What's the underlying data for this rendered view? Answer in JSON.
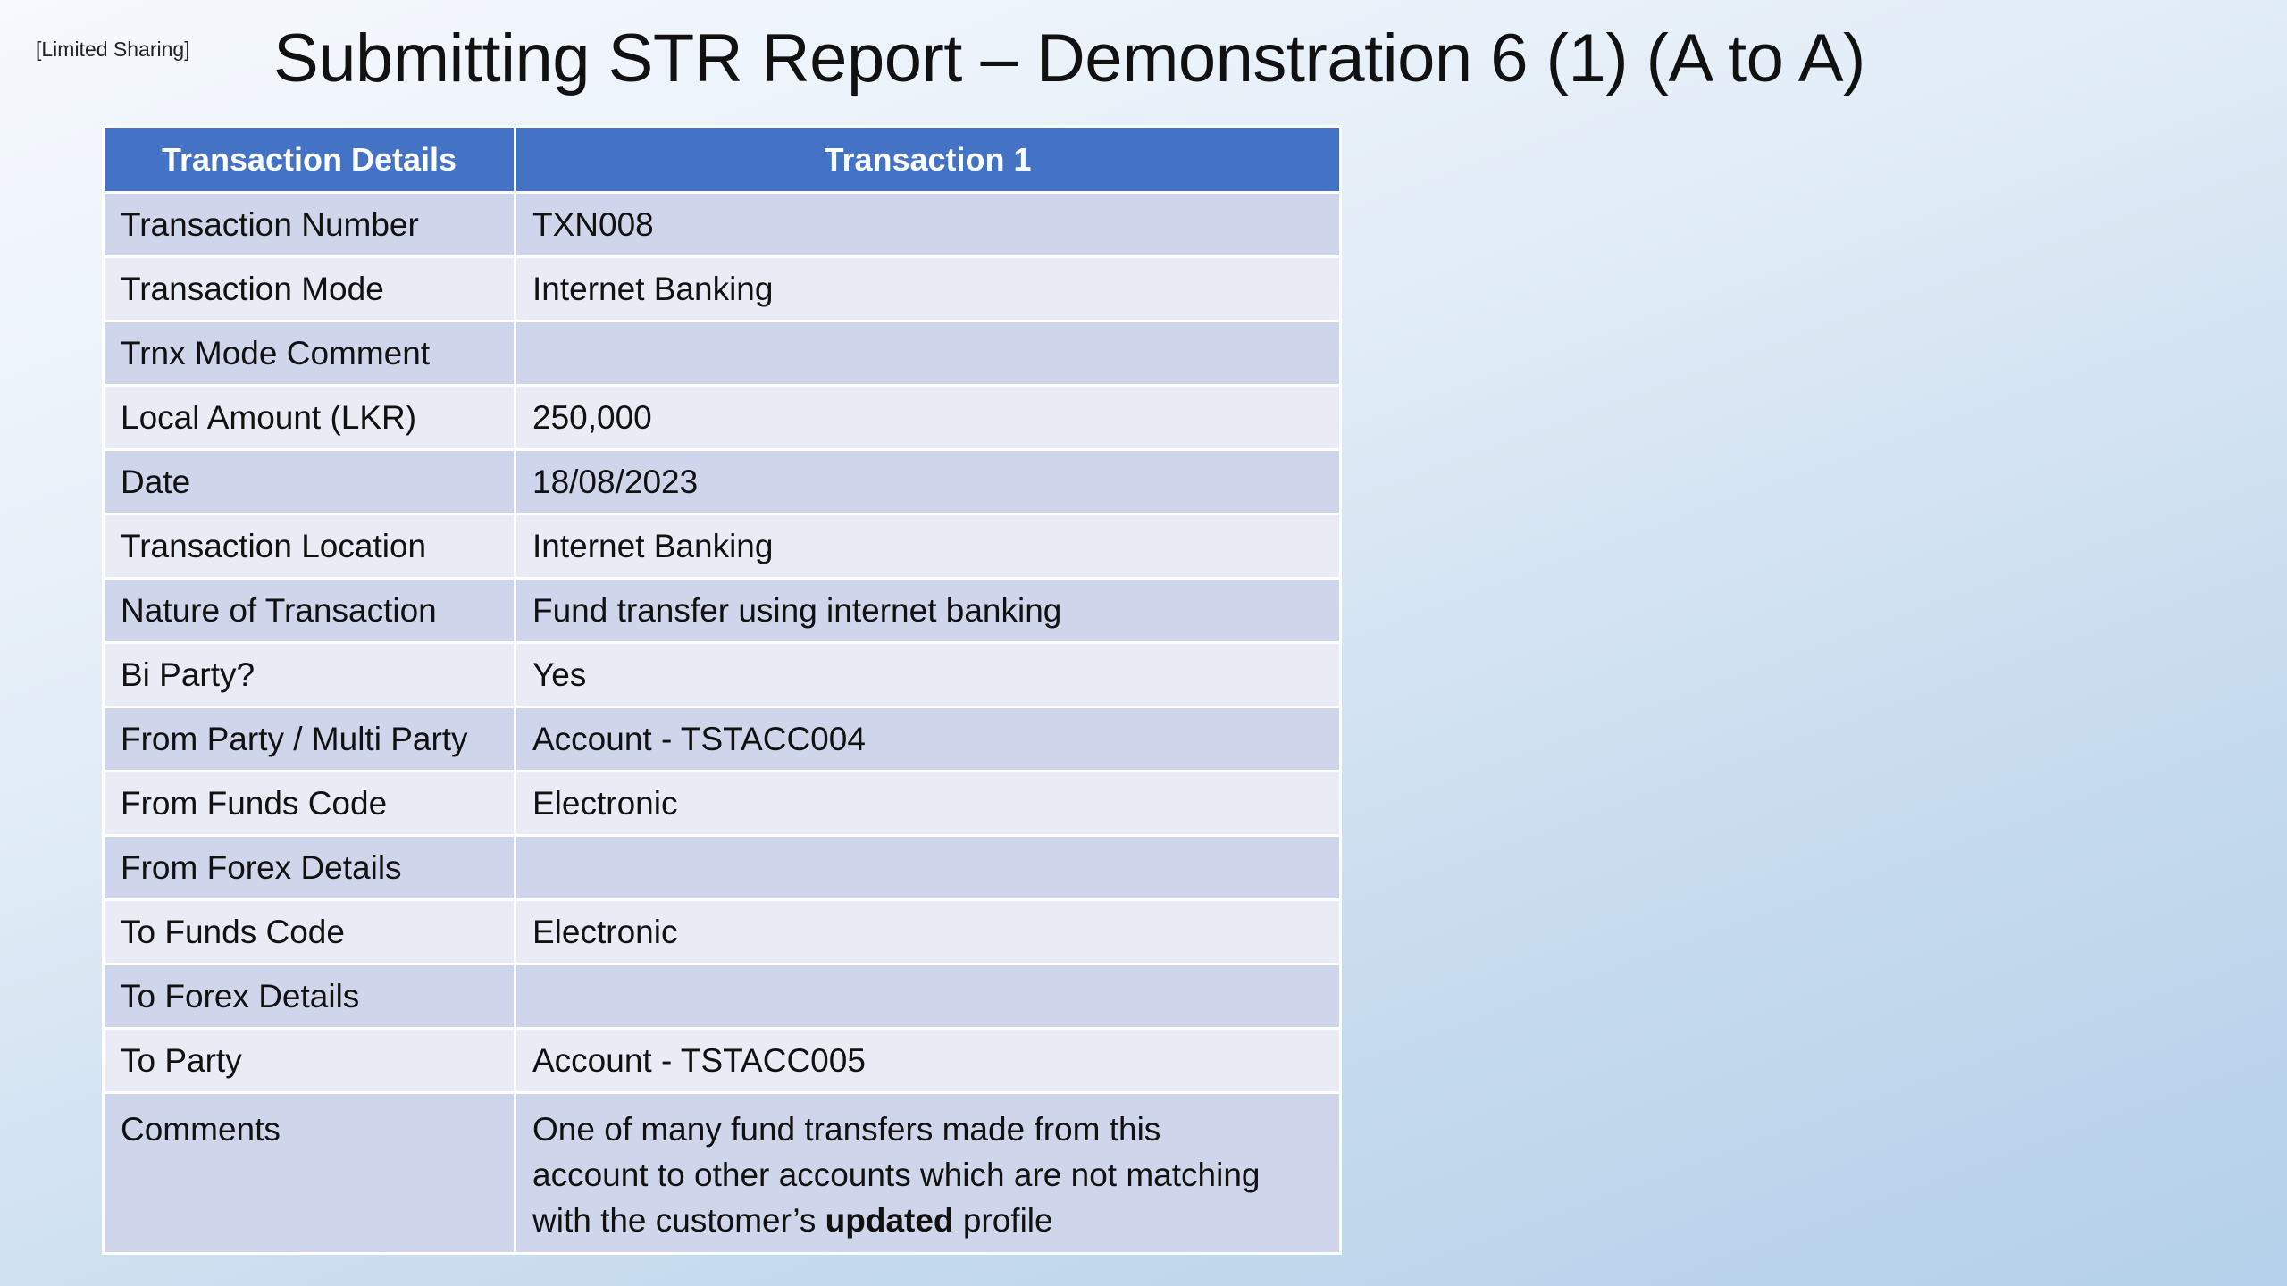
{
  "sharing_tag": "[Limited Sharing]",
  "title": "Submitting STR Report – Demonstration 6 (1) (A to A)",
  "table": {
    "headers": [
      "Transaction Details",
      "Transaction 1"
    ],
    "rows": [
      {
        "label": "Transaction Number",
        "value": "TXN008"
      },
      {
        "label": "Transaction Mode",
        "value": "Internet Banking"
      },
      {
        "label": "Trnx Mode Comment",
        "value": ""
      },
      {
        "label": "Local Amount (LKR)",
        "value": "250,000"
      },
      {
        "label": "Date",
        "value": "18/08/2023"
      },
      {
        "label": "Transaction Location",
        "value": "Internet Banking"
      },
      {
        "label": "Nature of Transaction",
        "value": "Fund transfer using internet banking"
      },
      {
        "label": "Bi Party?",
        "value": "Yes"
      },
      {
        "label": "From Party / Multi Party",
        "value": "Account - TSTACC004"
      },
      {
        "label": "From Funds Code",
        "value": "Electronic"
      },
      {
        "label": "From Forex Details",
        "value": ""
      },
      {
        "label": "To Funds Code",
        "value": "Electronic"
      },
      {
        "label": "To Forex Details",
        "value": ""
      },
      {
        "label": "To Party",
        "value": "Account - TSTACC005"
      }
    ],
    "comments": {
      "label": "Comments",
      "line1": "One of many fund transfers made from this",
      "line2": "account to other accounts which are not matching",
      "line3_before": "with the customer’s ",
      "line3_bold": "updated",
      "line3_after": " profile"
    }
  },
  "colors": {
    "header_bg": "#4472c4",
    "row_dark": "#cfd5ea",
    "row_light": "#e9ebf5"
  }
}
